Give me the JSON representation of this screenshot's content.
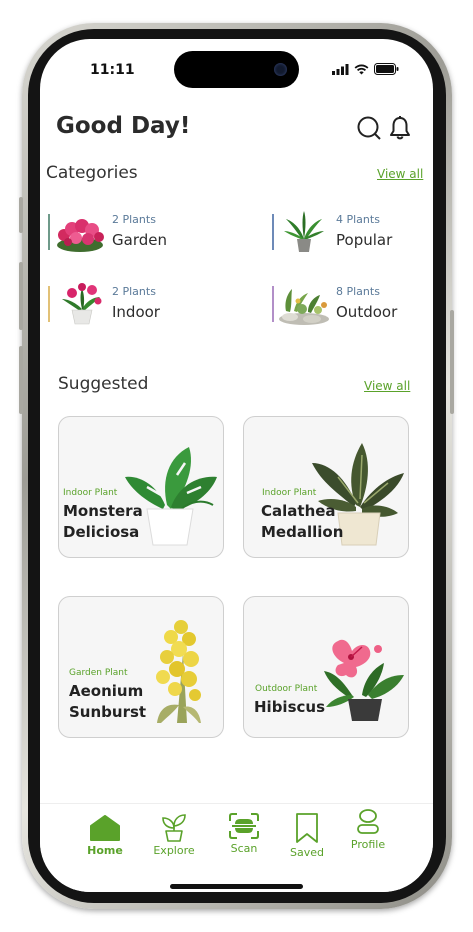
{
  "status_bar": {
    "time": "11:11"
  },
  "header": {
    "greeting": "Good Day!"
  },
  "categories": {
    "title": "Categories",
    "view_all": "View all",
    "items": [
      {
        "count": "2 Plants",
        "name": "Garden",
        "color": "#6f9a8a"
      },
      {
        "count": "4 Plants",
        "name": "Popular",
        "color": "#6d8ab8"
      },
      {
        "count": "2 Plants",
        "name": "Indoor",
        "color": "#e2c177"
      },
      {
        "count": "8 Plants",
        "name": "Outdoor",
        "color": "#b28fc8"
      }
    ]
  },
  "suggested": {
    "title": "Suggested",
    "view_all": "View all",
    "cards": [
      {
        "type": "Indoor Plant",
        "name": "Monstera\nDeliciosa"
      },
      {
        "type": "Indoor Plant",
        "name": "Calathea\nMedallion"
      },
      {
        "type": "Garden Plant",
        "name": "Aeonium\nSunburst"
      },
      {
        "type": "Outdoor Plant",
        "name": "Hibiscus"
      }
    ]
  },
  "nav": {
    "items": [
      {
        "label": "Home",
        "icon": "home-icon",
        "active": true
      },
      {
        "label": "Explore",
        "icon": "sprout-icon"
      },
      {
        "label": "Scan",
        "icon": "scan-icon"
      },
      {
        "label": "Saved",
        "icon": "bookmark-icon"
      },
      {
        "label": "Profile",
        "icon": "user-icon"
      }
    ]
  },
  "colors": {
    "accent": "#5aa22a",
    "text": "#2b2b2b",
    "count_text": "#5b7a99"
  }
}
